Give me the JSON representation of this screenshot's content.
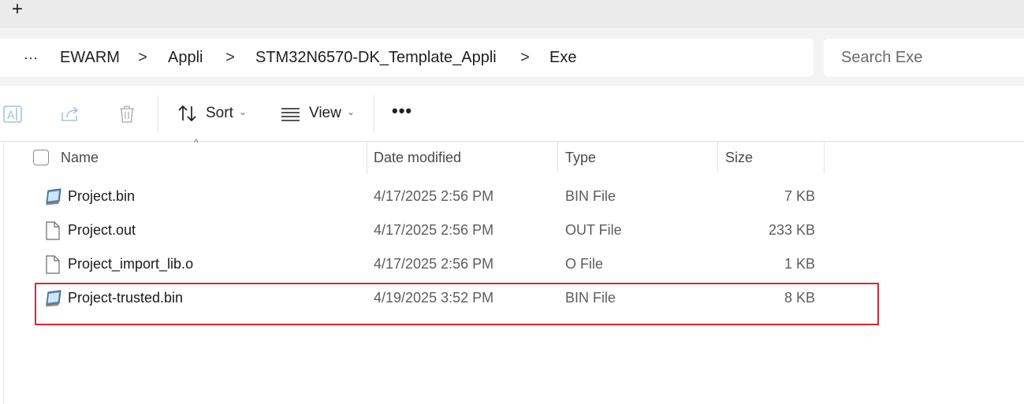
{
  "tabbar": {
    "new_tab_glyph": "+"
  },
  "breadcrumb": {
    "overflow": "···",
    "items": [
      "EWARM",
      "Appli",
      "STM32N6570-DK_Template_Appli",
      "Exe"
    ],
    "separator": ">"
  },
  "search": {
    "placeholder": "Search Exe"
  },
  "toolbar": {
    "sort_label": "Sort",
    "view_label": "View",
    "more_label": "•••"
  },
  "columns": {
    "name": "Name",
    "date": "Date modified",
    "type": "Type",
    "size": "Size"
  },
  "files": [
    {
      "name": "Project.bin",
      "date": "4/17/2025 2:56 PM",
      "type": "BIN File",
      "size": "7 KB",
      "icon": "bin-file-icon"
    },
    {
      "name": "Project.out",
      "date": "4/17/2025 2:56 PM",
      "type": "OUT File",
      "size": "233 KB",
      "icon": "generic-file-icon"
    },
    {
      "name": "Project_import_lib.o",
      "date": "4/17/2025 2:56 PM",
      "type": "O File",
      "size": "1 KB",
      "icon": "generic-file-icon"
    },
    {
      "name": "Project-trusted.bin",
      "date": "4/19/2025 3:52 PM",
      "type": "BIN File",
      "size": "8 KB",
      "icon": "bin-file-icon"
    }
  ],
  "colors": {
    "highlight": "#e0262e"
  }
}
